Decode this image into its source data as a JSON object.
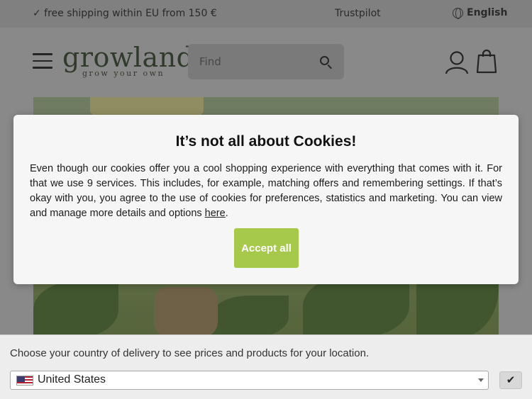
{
  "topbar": {
    "shipping_text": "✓ free shipping within EU from 150 €",
    "trustpilot_label": "Trustpilot",
    "language_label": "English"
  },
  "header": {
    "logo_name": "growland",
    "logo_tagline": "grow your own",
    "search": {
      "placeholder": "Find",
      "value": ""
    }
  },
  "cookie_modal": {
    "title": "It’s not all about Cookies!",
    "body_text": "Even though our cookies offer you a cool shopping experience with everything that comes with it. For that we use 9 services. This includes, for example, matching offers and remembering settings. If that’s okay with you, you agree to the use of cookies for preferences, statistics and marketing. You can view and manage more details and options ",
    "link_text": "here",
    "body_end": ".",
    "accept_label": "Accept all",
    "accent_color": "#a6c94c"
  },
  "country_bar": {
    "message": "Choose your country of delivery to see prices and products for your location.",
    "selected_country": "United States",
    "confirm_label": "✔"
  }
}
